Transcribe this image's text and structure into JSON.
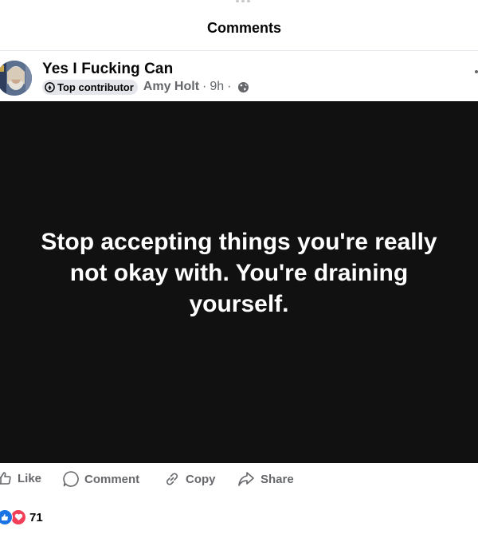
{
  "header": {
    "title": "Comments"
  },
  "post": {
    "group_name": "Yes I Fucking Can",
    "badge_label": "Top contributor",
    "author": "Amy Holt",
    "separator": "·",
    "time": "9h",
    "audience_icon": "globe-icon",
    "image_text": "Stop accepting things you're really not okay with. You're draining yourself."
  },
  "actions": {
    "like_label": "Like",
    "comment_label": "Comment",
    "copy_label": "Copy",
    "share_label": "Share"
  },
  "reactions": {
    "icons": [
      "like-icon",
      "love-icon"
    ],
    "count": "71"
  },
  "colors": {
    "text_primary": "#050505",
    "text_secondary": "#65676b",
    "image_bg": "#111111",
    "like_blue": "#1b74e4",
    "love_red": "#f33e58"
  }
}
